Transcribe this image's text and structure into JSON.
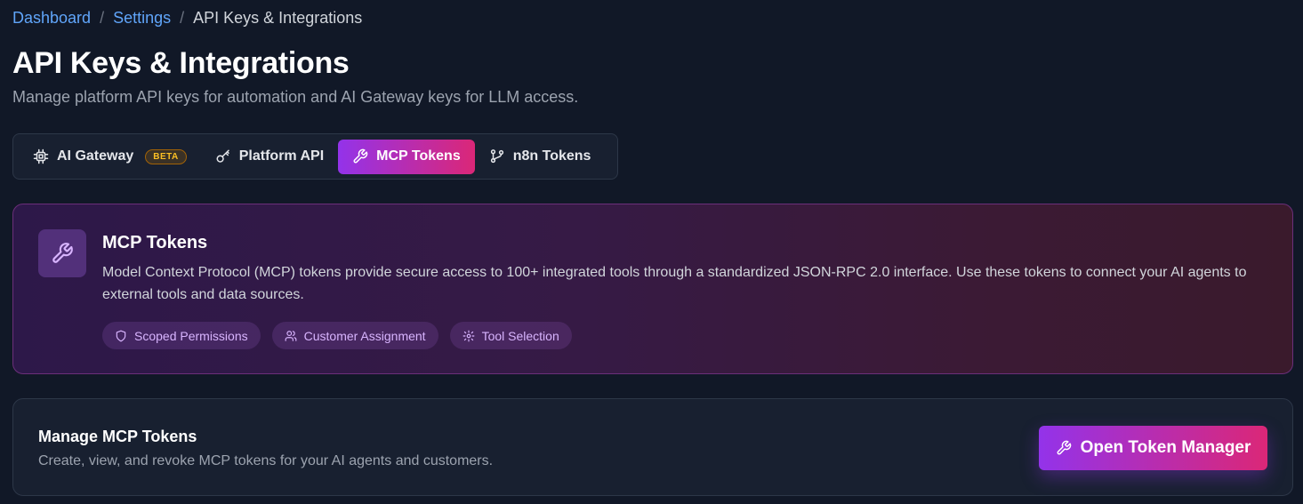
{
  "breadcrumb": {
    "items": [
      "Dashboard",
      "Settings"
    ],
    "separator": "/",
    "current": "API Keys & Integrations"
  },
  "page": {
    "title": "API Keys & Integrations",
    "subtitle": "Manage platform API keys for automation and AI Gateway keys for LLM access."
  },
  "tabs": [
    {
      "label": "AI Gateway",
      "icon": "cpu-icon",
      "badge": "BETA",
      "active": false
    },
    {
      "label": "Platform API",
      "icon": "key-icon",
      "active": false
    },
    {
      "label": "MCP Tokens",
      "icon": "wrench-icon",
      "active": true
    },
    {
      "label": "n8n Tokens",
      "icon": "git-branch-icon",
      "active": false
    }
  ],
  "info_card": {
    "icon": "wrench-icon",
    "title": "MCP Tokens",
    "description": "Model Context Protocol (MCP) tokens provide secure access to 100+ integrated tools through a standardized JSON-RPC 2.0 interface. Use these tokens to connect your AI agents to external tools and data sources.",
    "chips": [
      {
        "label": "Scoped Permissions",
        "icon": "shield-icon"
      },
      {
        "label": "Customer Assignment",
        "icon": "users-icon"
      },
      {
        "label": "Tool Selection",
        "icon": "gear-icon"
      }
    ]
  },
  "manage_card": {
    "title": "Manage MCP Tokens",
    "description": "Create, view, and revoke MCP tokens for your AI agents and customers.",
    "button_label": "Open Token Manager",
    "button_icon": "wrench-icon"
  },
  "colors": {
    "background": "#111827",
    "link": "#60a5fa",
    "accent_start": "#9333ea",
    "accent_end": "#db2777",
    "chip_text": "#d8b4fe",
    "beta": "#fbbf24"
  }
}
